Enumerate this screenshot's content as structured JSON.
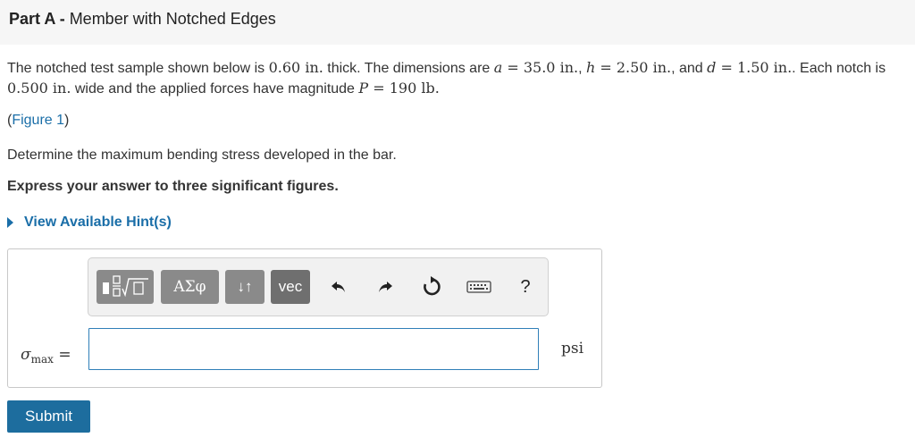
{
  "header": {
    "part_label": "Part A",
    "separator": " - ",
    "part_title": "Member with Notched Edges"
  },
  "problem": {
    "s1": "The notched test sample shown below is ",
    "thickness": "0.60 in.",
    "s2": " thick. The dimensions are ",
    "a_var": "a",
    "a_val": " = 35.0 in.",
    "s3": ", ",
    "h_var": "h",
    "h_val": " = 2.50 in.",
    "s4": ", and ",
    "d_var": "d",
    "d_val": " = 1.50 in.",
    "s5": ". Each notch is ",
    "notch": "0.500 in.",
    "s6": " wide and the applied forces have magnitude ",
    "p_var": "P",
    "p_val": " = 190 lb.",
    "s7": ""
  },
  "figure": {
    "open": "(",
    "link": "Figure 1",
    "close": ")"
  },
  "question": "Determine the maximum bending stress developed in the bar.",
  "instruction": "Express your answer to three significant figures.",
  "hint_label": "View Available Hint(s)",
  "toolbar": {
    "templates_icon": "fraction-sqrt-templates-icon",
    "symbols_label": "ΑΣφ",
    "arrows_label": "↓↑",
    "vec_label": "vec",
    "undo_icon": "undo-icon",
    "redo_icon": "redo-icon",
    "reset_icon": "reset-icon",
    "keyboard_icon": "keyboard-icon",
    "help_label": "?"
  },
  "answer": {
    "lhs_symbol": "σ",
    "lhs_sub": "max",
    "lhs_eq": " =",
    "value": "",
    "unit": "psi"
  },
  "submit_label": "Submit"
}
